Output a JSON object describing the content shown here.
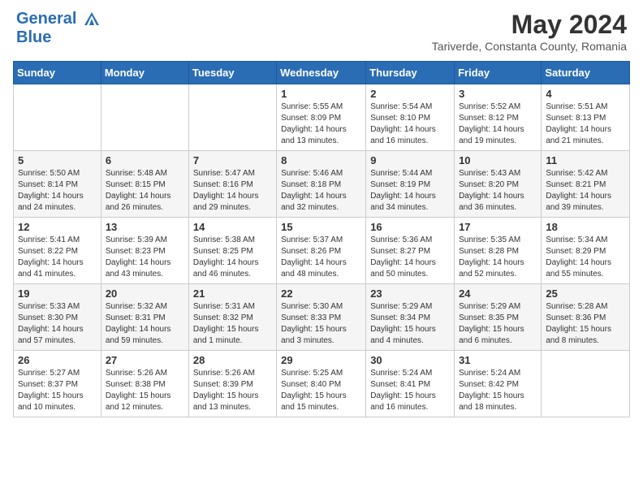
{
  "header": {
    "logo_line1": "General",
    "logo_line2": "Blue",
    "main_title": "May 2024",
    "subtitle": "Tariverde, Constanta County, Romania"
  },
  "calendar": {
    "days_of_week": [
      "Sunday",
      "Monday",
      "Tuesday",
      "Wednesday",
      "Thursday",
      "Friday",
      "Saturday"
    ],
    "weeks": [
      [
        {
          "day": "",
          "info": ""
        },
        {
          "day": "",
          "info": ""
        },
        {
          "day": "",
          "info": ""
        },
        {
          "day": "1",
          "info": "Sunrise: 5:55 AM\nSunset: 8:09 PM\nDaylight: 14 hours\nand 13 minutes."
        },
        {
          "day": "2",
          "info": "Sunrise: 5:54 AM\nSunset: 8:10 PM\nDaylight: 14 hours\nand 16 minutes."
        },
        {
          "day": "3",
          "info": "Sunrise: 5:52 AM\nSunset: 8:12 PM\nDaylight: 14 hours\nand 19 minutes."
        },
        {
          "day": "4",
          "info": "Sunrise: 5:51 AM\nSunset: 8:13 PM\nDaylight: 14 hours\nand 21 minutes."
        }
      ],
      [
        {
          "day": "5",
          "info": "Sunrise: 5:50 AM\nSunset: 8:14 PM\nDaylight: 14 hours\nand 24 minutes."
        },
        {
          "day": "6",
          "info": "Sunrise: 5:48 AM\nSunset: 8:15 PM\nDaylight: 14 hours\nand 26 minutes."
        },
        {
          "day": "7",
          "info": "Sunrise: 5:47 AM\nSunset: 8:16 PM\nDaylight: 14 hours\nand 29 minutes."
        },
        {
          "day": "8",
          "info": "Sunrise: 5:46 AM\nSunset: 8:18 PM\nDaylight: 14 hours\nand 32 minutes."
        },
        {
          "day": "9",
          "info": "Sunrise: 5:44 AM\nSunset: 8:19 PM\nDaylight: 14 hours\nand 34 minutes."
        },
        {
          "day": "10",
          "info": "Sunrise: 5:43 AM\nSunset: 8:20 PM\nDaylight: 14 hours\nand 36 minutes."
        },
        {
          "day": "11",
          "info": "Sunrise: 5:42 AM\nSunset: 8:21 PM\nDaylight: 14 hours\nand 39 minutes."
        }
      ],
      [
        {
          "day": "12",
          "info": "Sunrise: 5:41 AM\nSunset: 8:22 PM\nDaylight: 14 hours\nand 41 minutes."
        },
        {
          "day": "13",
          "info": "Sunrise: 5:39 AM\nSunset: 8:23 PM\nDaylight: 14 hours\nand 43 minutes."
        },
        {
          "day": "14",
          "info": "Sunrise: 5:38 AM\nSunset: 8:25 PM\nDaylight: 14 hours\nand 46 minutes."
        },
        {
          "day": "15",
          "info": "Sunrise: 5:37 AM\nSunset: 8:26 PM\nDaylight: 14 hours\nand 48 minutes."
        },
        {
          "day": "16",
          "info": "Sunrise: 5:36 AM\nSunset: 8:27 PM\nDaylight: 14 hours\nand 50 minutes."
        },
        {
          "day": "17",
          "info": "Sunrise: 5:35 AM\nSunset: 8:28 PM\nDaylight: 14 hours\nand 52 minutes."
        },
        {
          "day": "18",
          "info": "Sunrise: 5:34 AM\nSunset: 8:29 PM\nDaylight: 14 hours\nand 55 minutes."
        }
      ],
      [
        {
          "day": "19",
          "info": "Sunrise: 5:33 AM\nSunset: 8:30 PM\nDaylight: 14 hours\nand 57 minutes."
        },
        {
          "day": "20",
          "info": "Sunrise: 5:32 AM\nSunset: 8:31 PM\nDaylight: 14 hours\nand 59 minutes."
        },
        {
          "day": "21",
          "info": "Sunrise: 5:31 AM\nSunset: 8:32 PM\nDaylight: 15 hours\nand 1 minute."
        },
        {
          "day": "22",
          "info": "Sunrise: 5:30 AM\nSunset: 8:33 PM\nDaylight: 15 hours\nand 3 minutes."
        },
        {
          "day": "23",
          "info": "Sunrise: 5:29 AM\nSunset: 8:34 PM\nDaylight: 15 hours\nand 4 minutes."
        },
        {
          "day": "24",
          "info": "Sunrise: 5:29 AM\nSunset: 8:35 PM\nDaylight: 15 hours\nand 6 minutes."
        },
        {
          "day": "25",
          "info": "Sunrise: 5:28 AM\nSunset: 8:36 PM\nDaylight: 15 hours\nand 8 minutes."
        }
      ],
      [
        {
          "day": "26",
          "info": "Sunrise: 5:27 AM\nSunset: 8:37 PM\nDaylight: 15 hours\nand 10 minutes."
        },
        {
          "day": "27",
          "info": "Sunrise: 5:26 AM\nSunset: 8:38 PM\nDaylight: 15 hours\nand 12 minutes."
        },
        {
          "day": "28",
          "info": "Sunrise: 5:26 AM\nSunset: 8:39 PM\nDaylight: 15 hours\nand 13 minutes."
        },
        {
          "day": "29",
          "info": "Sunrise: 5:25 AM\nSunset: 8:40 PM\nDaylight: 15 hours\nand 15 minutes."
        },
        {
          "day": "30",
          "info": "Sunrise: 5:24 AM\nSunset: 8:41 PM\nDaylight: 15 hours\nand 16 minutes."
        },
        {
          "day": "31",
          "info": "Sunrise: 5:24 AM\nSunset: 8:42 PM\nDaylight: 15 hours\nand 18 minutes."
        },
        {
          "day": "",
          "info": ""
        }
      ]
    ]
  }
}
